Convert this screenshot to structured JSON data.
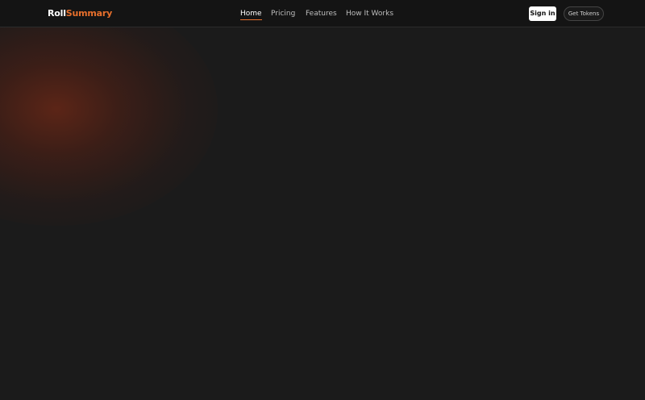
{
  "brand": {
    "name_part1": "Roll",
    "name_part2": "Summary",
    "accent_color": "#e8702c"
  },
  "nav": {
    "items": [
      {
        "label": "Home",
        "active": true
      },
      {
        "label": "Pricing",
        "active": false
      },
      {
        "label": "Features",
        "active": false
      },
      {
        "label": "How It Works",
        "active": false
      }
    ]
  },
  "actions": {
    "sign_in_label": "Sign in",
    "get_tokens_label": "Get Tokens"
  },
  "theme": {
    "background": "#1b1b1b",
    "header_background": "#141414",
    "glow_color": "#6e2816"
  }
}
